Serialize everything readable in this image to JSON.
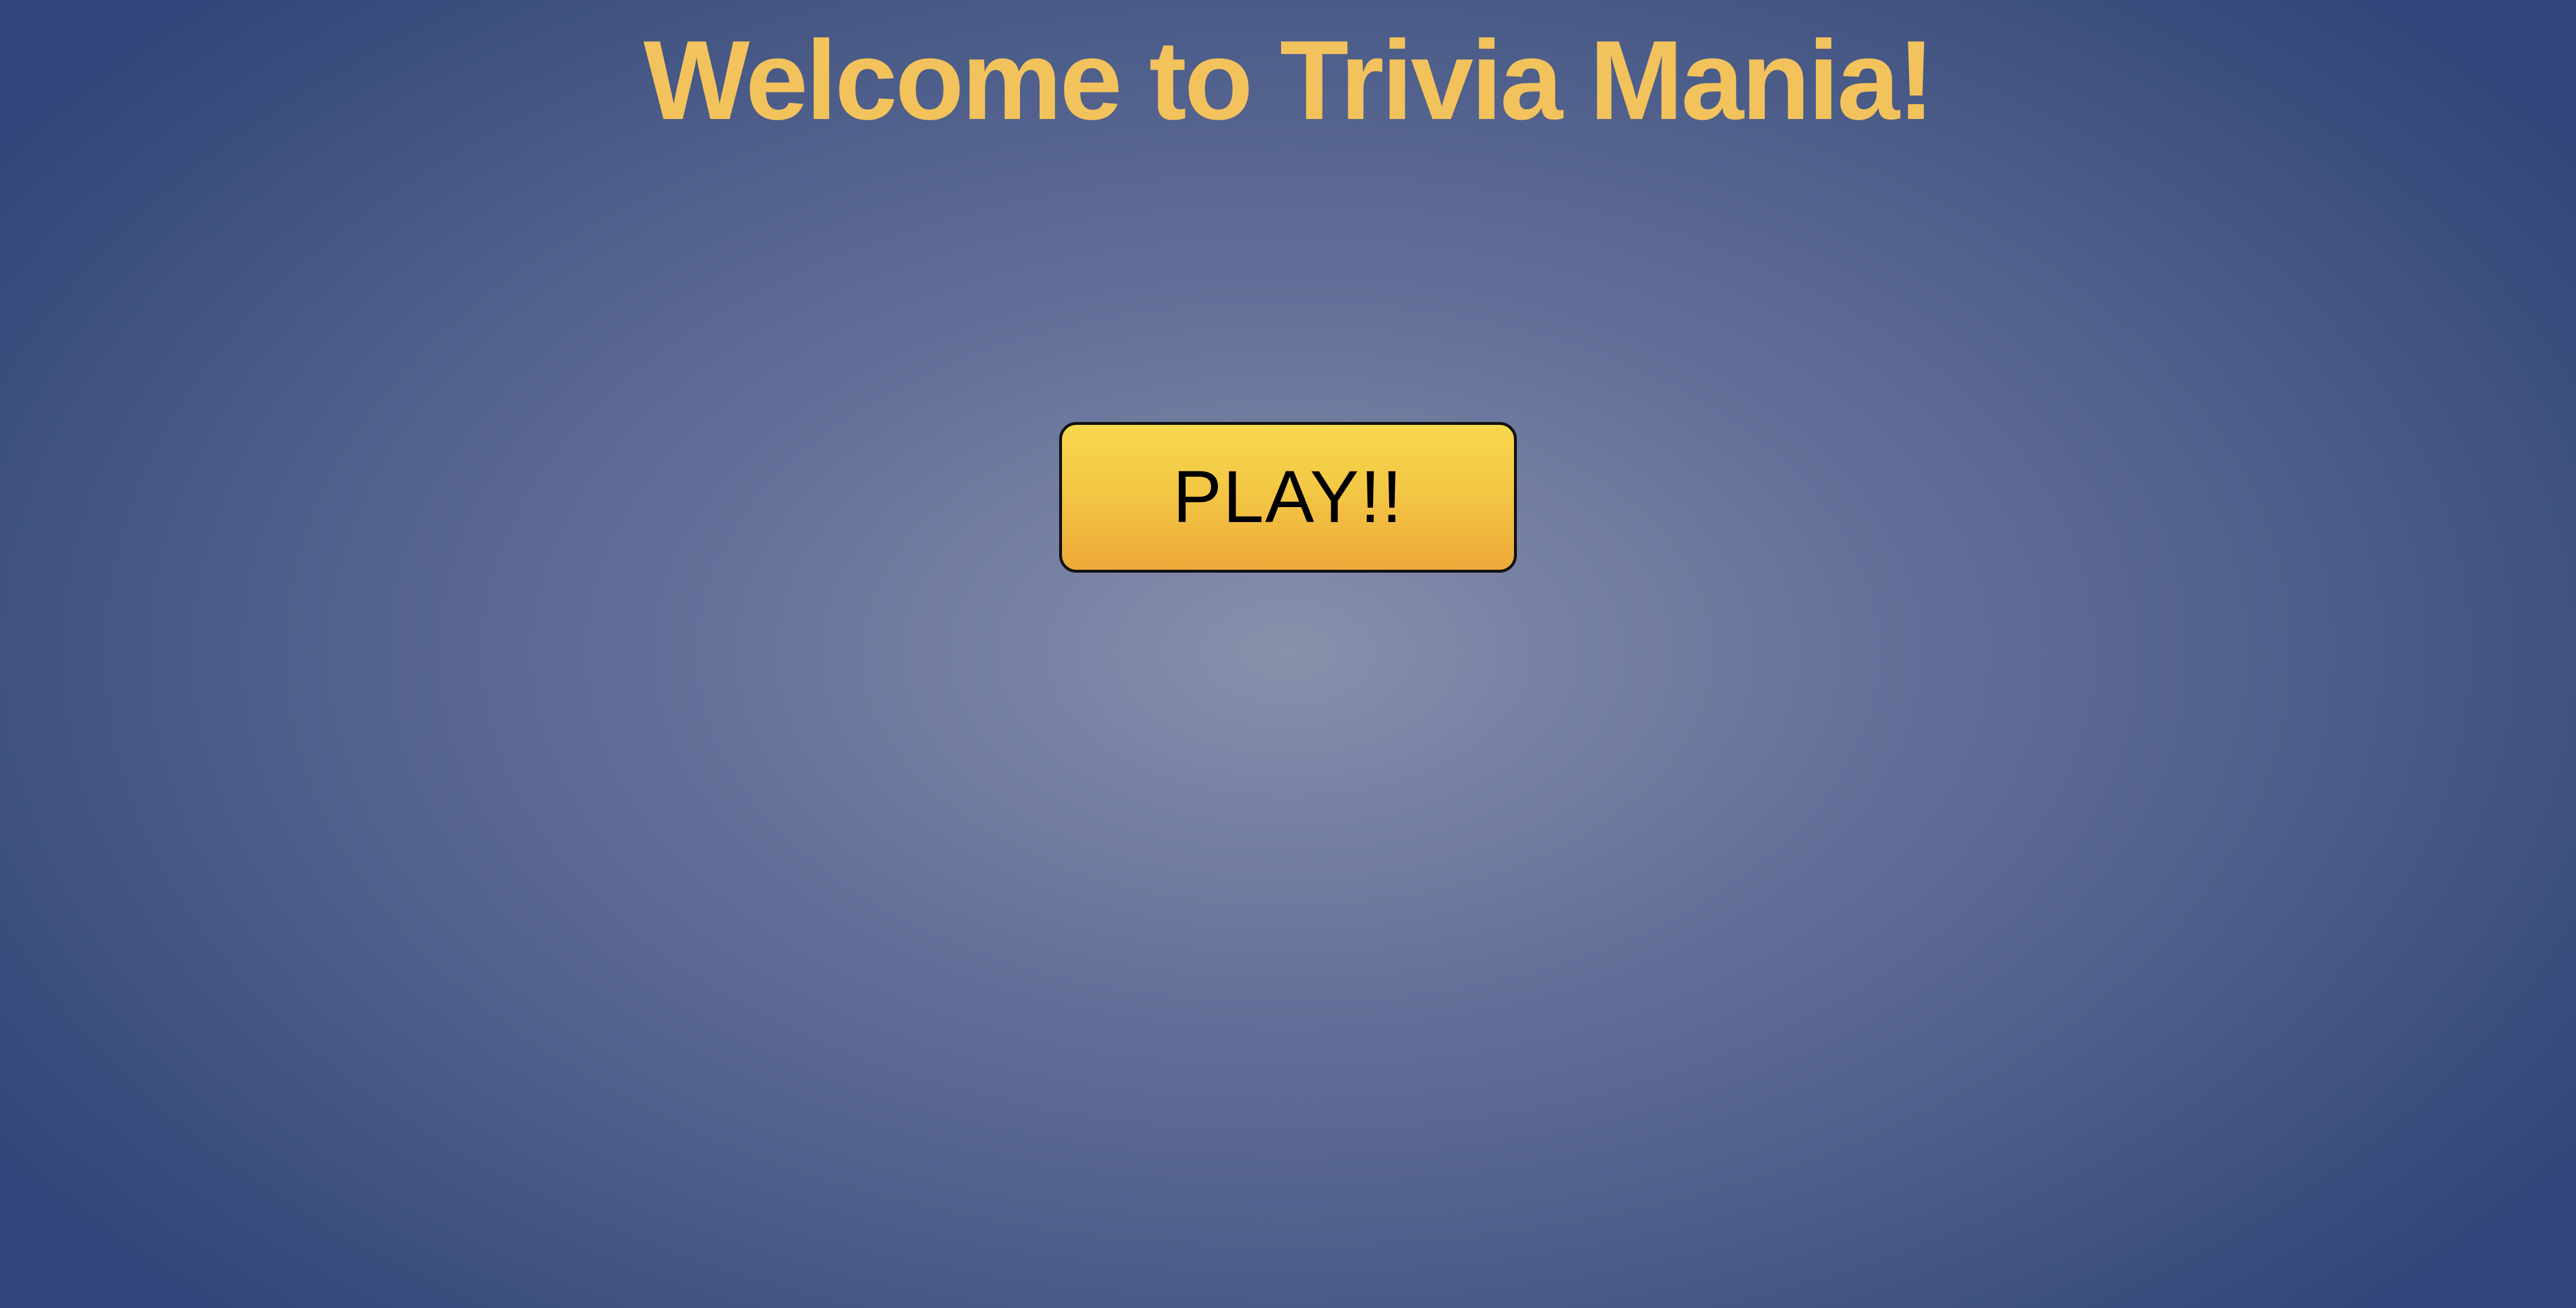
{
  "header": {
    "title": "Welcome to Trivia Mania!"
  },
  "main": {
    "play_button_label": "PLAY!!"
  },
  "colors": {
    "title": "#f2c25c",
    "button_top": "#f7d84e",
    "button_bottom": "#eea93a",
    "background_center": "#8990ab",
    "background_edge": "#30467a"
  }
}
